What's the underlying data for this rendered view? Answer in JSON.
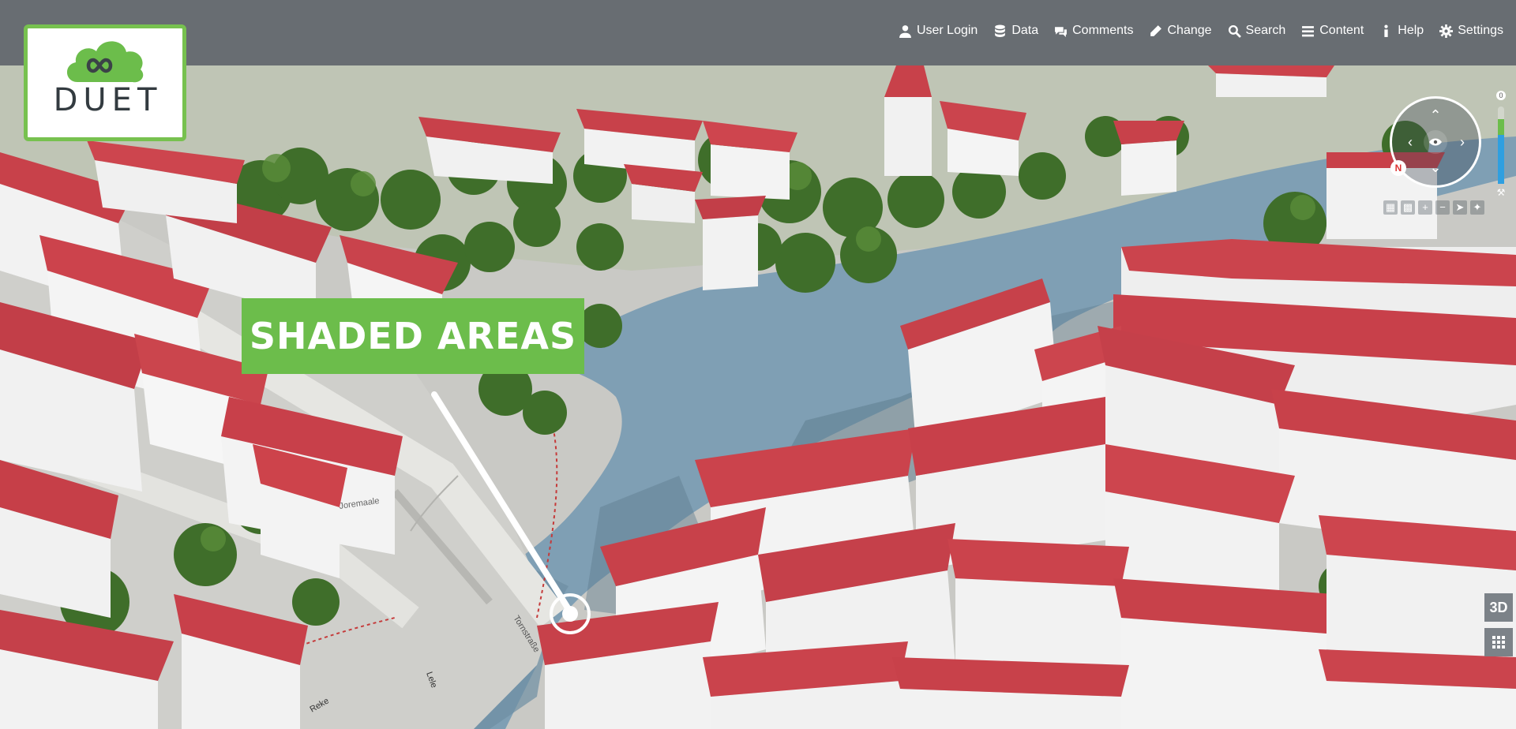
{
  "brand": {
    "name": "DUET",
    "accent_green": "#6cbd4b",
    "logo_icon": "cloud-infinity-icon"
  },
  "nav": [
    {
      "label": "User Login",
      "icon": "user-icon"
    },
    {
      "label": "Data",
      "icon": "database-icon"
    },
    {
      "label": "Comments",
      "icon": "comments-icon"
    },
    {
      "label": "Change",
      "icon": "pencil-icon"
    },
    {
      "label": "Search",
      "icon": "search-icon"
    },
    {
      "label": "Content",
      "icon": "list-icon"
    },
    {
      "label": "Help",
      "icon": "info-icon"
    },
    {
      "label": "Settings",
      "icon": "gear-icon"
    }
  ],
  "callout": {
    "text": "SHADED AREAS"
  },
  "map_controls": {
    "compass_north_label": "N",
    "view_mode_button": "3D",
    "zoom_top_label": "0"
  },
  "map_labels": {
    "street_1": "Joremaale",
    "street_2": "Tornstraße",
    "water_1": "Reke",
    "water_2": "Lele"
  },
  "colors": {
    "roof": "#c8414a",
    "water": "#7e9fb5",
    "trees": "#3f6e2a",
    "ground": "#c7c7c3"
  }
}
